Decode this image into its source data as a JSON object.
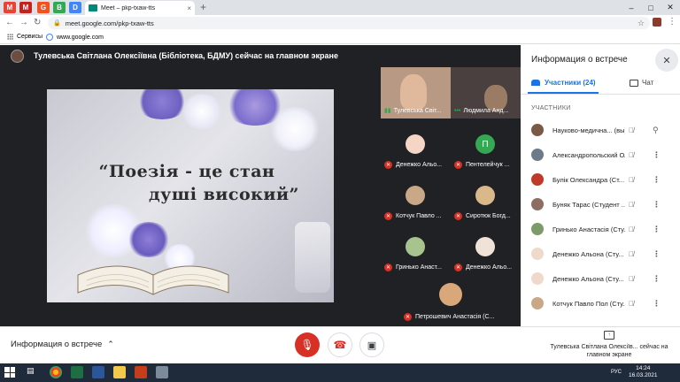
{
  "browser": {
    "pinned_tabs": [
      "M",
      "M",
      "G",
      "B",
      "D"
    ],
    "active_tab": {
      "title": "Meet – pkp-txaw-tts",
      "close": "×"
    },
    "new_tab": "+",
    "url": "meet.google.com/pkp-txaw-tts",
    "bookmarks": [
      {
        "label": "Сервисы"
      },
      {
        "label": "www.google.com"
      }
    ]
  },
  "presenter": {
    "banner": "Тулевська Світлана Олексіївна (Бібліотека, БДМУ) сейчас на главном экране"
  },
  "slide": {
    "line1": "“Поезія - це стан",
    "line2": "душі високий”"
  },
  "tiles": [
    {
      "label": "Тулевська Світ..."
    },
    {
      "label": "Людмила Анд..."
    },
    {
      "label": "Денежко Альо..."
    },
    {
      "label": "Пентелейчук ...",
      "initial": "П"
    },
    {
      "label": "Котчук Павло ..."
    },
    {
      "label": "Сиротюк Богд..."
    },
    {
      "label": "Гринько Анаст..."
    },
    {
      "label": "Денежко Альо..."
    },
    {
      "label": "Петрошевич Анастасія (С..."
    }
  ],
  "panel": {
    "title": "Информация о встрече",
    "tab_people": "Участники (24)",
    "tab_chat": "Чат",
    "section": "УЧАСТНИКИ",
    "participants": [
      {
        "name": "Науково-медична...",
        "suffix": "(вы)"
      },
      {
        "name": "Александропольский Оле..."
      },
      {
        "name": "Булік Олександра (Ст..."
      },
      {
        "name": "Буняк Тарас (Студент ..."
      },
      {
        "name": "Гринько Анастасія (Сту..."
      },
      {
        "name": "Денежко Альона (Сту..."
      },
      {
        "name": "Денежко Альона (Сту..."
      },
      {
        "name": "Котчук Павло Пол (Сту..."
      }
    ]
  },
  "bottom": {
    "meeting_info": "Информация о встрече",
    "present_text": "Тулевська Світлана Олексіїв... сейчас на главном экране"
  },
  "taskbar": {
    "lang": "РУС",
    "time": "14:24",
    "date": "16.03.2021"
  },
  "colors": {
    "meet_bg": "#202124",
    "accent": "#1a73e8",
    "danger": "#d93025"
  }
}
